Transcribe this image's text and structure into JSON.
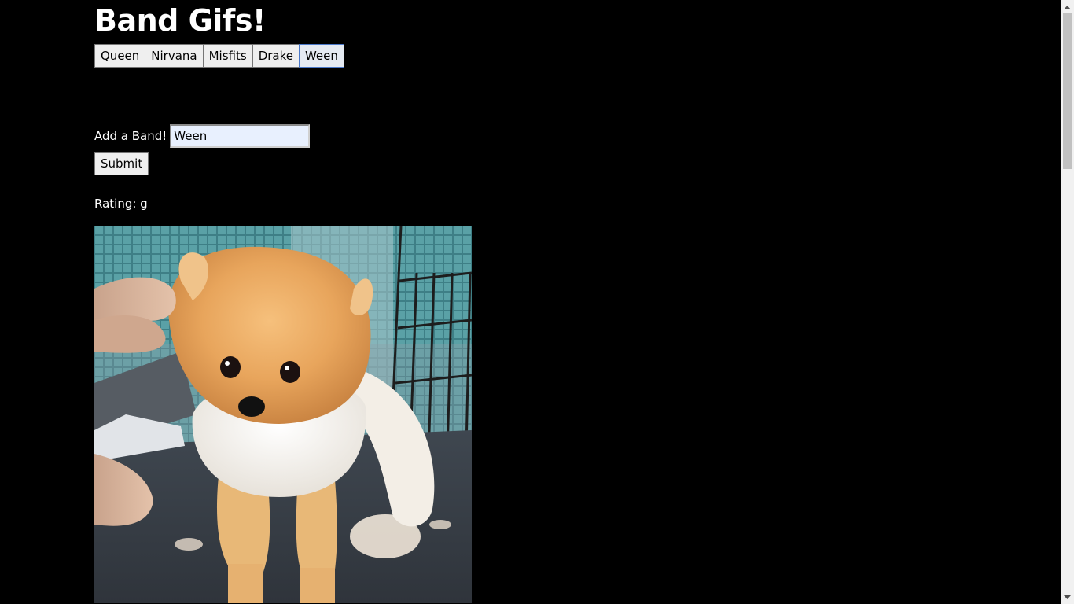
{
  "header": {
    "title": "Band Gifs!"
  },
  "band_buttons": [
    {
      "label": "Queen"
    },
    {
      "label": "Nirvana"
    },
    {
      "label": "Misfits"
    },
    {
      "label": "Drake"
    },
    {
      "label": "Ween"
    }
  ],
  "add_form": {
    "label": "Add a Band!",
    "input_value": "Ween",
    "submit_label": "Submit"
  },
  "results": {
    "rating_text": "Rating: g",
    "gif_alt": "pomeranian dog being groomed"
  },
  "colors": {
    "background": "#000000",
    "text": "#ffffff",
    "input_background": "#e8f0fe",
    "button_background": "#efefef"
  }
}
